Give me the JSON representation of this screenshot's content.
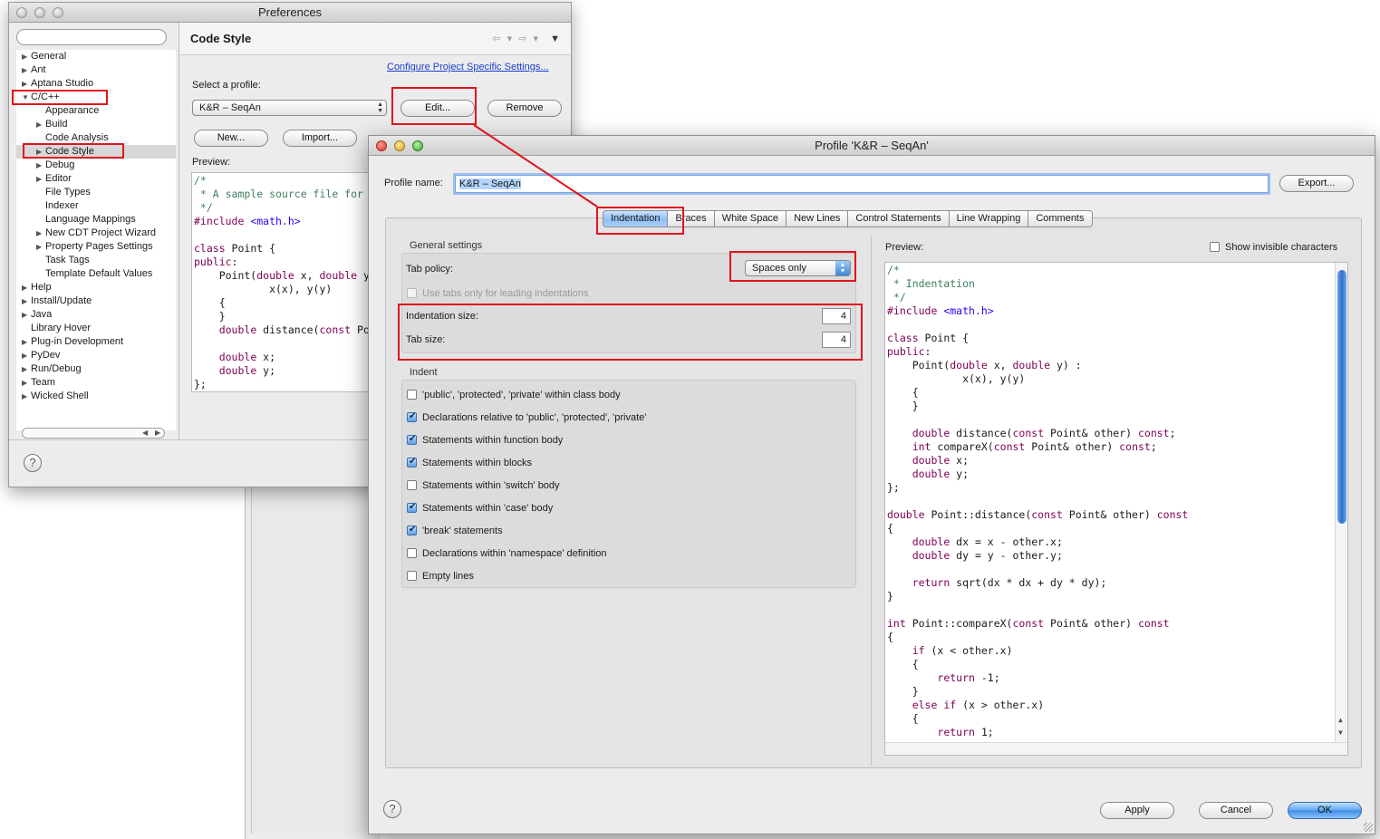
{
  "preferences": {
    "window_title": "Preferences",
    "search_placeholder": "",
    "tree": [
      {
        "label": "General",
        "level": 0,
        "arrow": "right"
      },
      {
        "label": "Ant",
        "level": 0,
        "arrow": "right"
      },
      {
        "label": "Aptana Studio",
        "level": 0,
        "arrow": "right"
      },
      {
        "label": "C/C++",
        "level": 0,
        "arrow": "down"
      },
      {
        "label": "Appearance",
        "level": 1,
        "arrow": "none"
      },
      {
        "label": "Build",
        "level": 1,
        "arrow": "right"
      },
      {
        "label": "Code Analysis",
        "level": 1,
        "arrow": "none"
      },
      {
        "label": "Code Style",
        "level": 1,
        "arrow": "right"
      },
      {
        "label": "Debug",
        "level": 1,
        "arrow": "right"
      },
      {
        "label": "Editor",
        "level": 1,
        "arrow": "right"
      },
      {
        "label": "File Types",
        "level": 1,
        "arrow": "none"
      },
      {
        "label": "Indexer",
        "level": 1,
        "arrow": "none"
      },
      {
        "label": "Language Mappings",
        "level": 1,
        "arrow": "none"
      },
      {
        "label": "New CDT Project Wizard",
        "level": 1,
        "arrow": "right"
      },
      {
        "label": "Property Pages Settings",
        "level": 1,
        "arrow": "right"
      },
      {
        "label": "Task Tags",
        "level": 1,
        "arrow": "none"
      },
      {
        "label": "Template Default Values",
        "level": 1,
        "arrow": "none"
      },
      {
        "label": "Help",
        "level": 0,
        "arrow": "right"
      },
      {
        "label": "Install/Update",
        "level": 0,
        "arrow": "right"
      },
      {
        "label": "Java",
        "level": 0,
        "arrow": "right"
      },
      {
        "label": "Library Hover",
        "level": 0,
        "arrow": "none"
      },
      {
        "label": "Plug-in Development",
        "level": 0,
        "arrow": "right"
      },
      {
        "label": "PyDev",
        "level": 0,
        "arrow": "right"
      },
      {
        "label": "Run/Debug",
        "level": 0,
        "arrow": "right"
      },
      {
        "label": "Team",
        "level": 0,
        "arrow": "right"
      },
      {
        "label": "Wicked Shell",
        "level": 0,
        "arrow": "right"
      }
    ],
    "page_title": "Code Style",
    "nav_arrows": "⇦ ▾ ⇨ ▾",
    "nav_menu": "▼",
    "configure_link": "Configure Project Specific Settings...",
    "select_profile_label": "Select a profile:",
    "profile_value": "K&R – SeqAn",
    "edit_button": "Edit...",
    "remove_button": "Remove",
    "new_button": "New...",
    "import_button": "Import...",
    "preview_label": "Preview:",
    "preview_code": [
      {
        "text": "/*",
        "cls": "c-comment"
      },
      {
        "text": " * A sample source file for",
        "cls": "c-comment"
      },
      {
        "text": " */",
        "cls": "c-comment"
      },
      {
        "text": "#include <math.h>",
        "cls": "inc"
      },
      {
        "text": "",
        "cls": ""
      },
      {
        "text": "class Point {",
        "cls": "kw1"
      },
      {
        "text": "public:",
        "cls": "c-kw"
      },
      {
        "text": "    Point(double x, double y",
        "cls": "pt"
      },
      {
        "text": "            x(x), y(y)",
        "cls": ""
      },
      {
        "text": "    {",
        "cls": ""
      },
      {
        "text": "    }",
        "cls": ""
      },
      {
        "text": "    double distance(const Po",
        "cls": "dist"
      },
      {
        "text": "",
        "cls": ""
      },
      {
        "text": "    double x;",
        "cls": "dbl"
      },
      {
        "text": "    double y;",
        "cls": "dbl"
      },
      {
        "text": "};",
        "cls": ""
      }
    ],
    "help_glyph": "?"
  },
  "profile": {
    "window_title": "Profile 'K&R – SeqAn'",
    "profile_name_label": "Profile name:",
    "profile_name_value": "K&R – SeqAn",
    "export_button": "Export...",
    "tabs": [
      "Indentation",
      "Braces",
      "White Space",
      "New Lines",
      "Control Statements",
      "Line Wrapping",
      "Comments"
    ],
    "active_tab": "Indentation",
    "general_settings_label": "General settings",
    "tab_policy_label": "Tab policy:",
    "tab_policy_value": "Spaces only",
    "use_tabs_label": "Use tabs only for leading indentations",
    "indentation_size_label": "Indentation size:",
    "indentation_size_value": "4",
    "tab_size_label": "Tab size:",
    "tab_size_value": "4",
    "indent_label": "Indent",
    "indent_options": [
      {
        "label": "'public', 'protected', 'private' within class body",
        "checked": false
      },
      {
        "label": "Declarations relative to 'public', 'protected', 'private'",
        "checked": true
      },
      {
        "label": "Statements within function body",
        "checked": true
      },
      {
        "label": "Statements within blocks",
        "checked": true
      },
      {
        "label": "Statements within 'switch' body",
        "checked": false
      },
      {
        "label": "Statements within 'case' body",
        "checked": true
      },
      {
        "label": "'break' statements",
        "checked": true
      },
      {
        "label": "Declarations within 'namespace' definition",
        "checked": false
      },
      {
        "label": "Empty lines",
        "checked": false
      }
    ],
    "preview_label": "Preview:",
    "show_invisible_label": "Show invisible characters",
    "preview_code": [
      "/*",
      " * Indentation",
      " */",
      "#include <math.h>",
      "",
      "class Point {",
      "public:",
      "    Point(double x, double y) :",
      "            x(x), y(y)",
      "    {",
      "    }",
      "",
      "    double distance(const Point& other) const;",
      "    int compareX(const Point& other) const;",
      "    double x;",
      "    double y;",
      "};",
      "",
      "double Point::distance(const Point& other) const",
      "{",
      "    double dx = x - other.x;",
      "    double dy = y - other.y;",
      "",
      "    return sqrt(dx * dx + dy * dy);",
      "}",
      "",
      "int Point::compareX(const Point& other) const",
      "{",
      "    if (x < other.x)",
      "    {",
      "        return -1;",
      "    }",
      "    else if (x > other.x)",
      "    {",
      "        return 1;"
    ],
    "apply_button": "Apply",
    "cancel_button": "Cancel",
    "ok_button": "OK",
    "help_glyph": "?"
  },
  "colors": {
    "annotation": "#e0141e",
    "comment": "#3f7f5f",
    "keyword": "#7f0055",
    "header_string": "#2a00ff"
  }
}
